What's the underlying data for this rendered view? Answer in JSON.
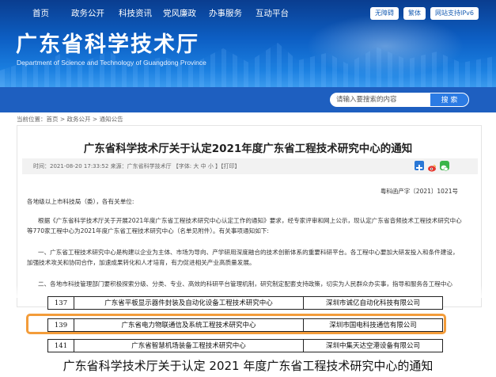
{
  "header": {
    "title": "广东省科学技术厅",
    "subtitle": "Department of Science and Technology of Guangdong Province",
    "buttons": [
      "无障碍",
      "繁体",
      "网站支持IPv6"
    ]
  },
  "nav": {
    "items": [
      "首页",
      "政务公开",
      "科技资讯",
      "党风廉政",
      "办事服务",
      "互动平台"
    ],
    "search_placeholder": "请输入要搜索的内容",
    "search_button": "搜 索"
  },
  "breadcrumb": "当前位置：首页 > 政务公开 > 通知公告",
  "article": {
    "title": "广东省科学技术厅关于认定2021年度广东省工程技术研究中心的通知",
    "meta": "时间：2021-08-20 17:33:52    来源：广东省科学技术厅 【字体: 大  中  小 】【打印】",
    "doc_number": "粤科函产字〔2021〕1021号",
    "greeting": "各地级以上市科技局（委），各有关单位:",
    "para1": "根据《广东省科学技术厅关于开展2021年度广东省工程技术研究中心认定工作的通知》要求，经专家评审和网上公示，现认定广东省音频技术工程技术研究中心等770家工程中心为2021年度广东省工程技术研究中心（名单见附件）。有关事项通知如下:",
    "para2": "一、广东省工程技术研究中心是构建以企业为主体、市场为导向、产学研用深度融合的技术创新体系的重要科研平台。各工程中心要加大研发投入和条件建设，加强技术攻关和协同合作，加速成果转化和人才培育，有力促进相关产业高质量发展。",
    "para3": "二、各地市科技管理部门要积极探索分级、分类、专业、高效的科研平台管理机制，研究制定配套支持政策，切实为人民群众办实事，指导和服务各工程中心"
  },
  "table": {
    "rows": [
      {
        "num": "137",
        "name": "广东省平板显示器件封装及自动化设备工程技术研究中心",
        "org": "深圳市诚亿自动化科技有限公司"
      },
      {
        "num": "139",
        "name": "广东省电力物联通信及系统工程技术研究中心",
        "org": "深圳市国电科技通信有限公司"
      },
      {
        "num": "141",
        "name": "广东省智慧机场装备工程技术研究中心",
        "org": "深圳中集天达空港设备有限公司"
      }
    ]
  },
  "caption": "广东省科学技术厅关于认定 2021 年度广东省工程技术研究中心的通知",
  "colors": {
    "banner": "#0d5fc4",
    "nav": "#1e5fc0",
    "highlight": "#f39c3a"
  }
}
